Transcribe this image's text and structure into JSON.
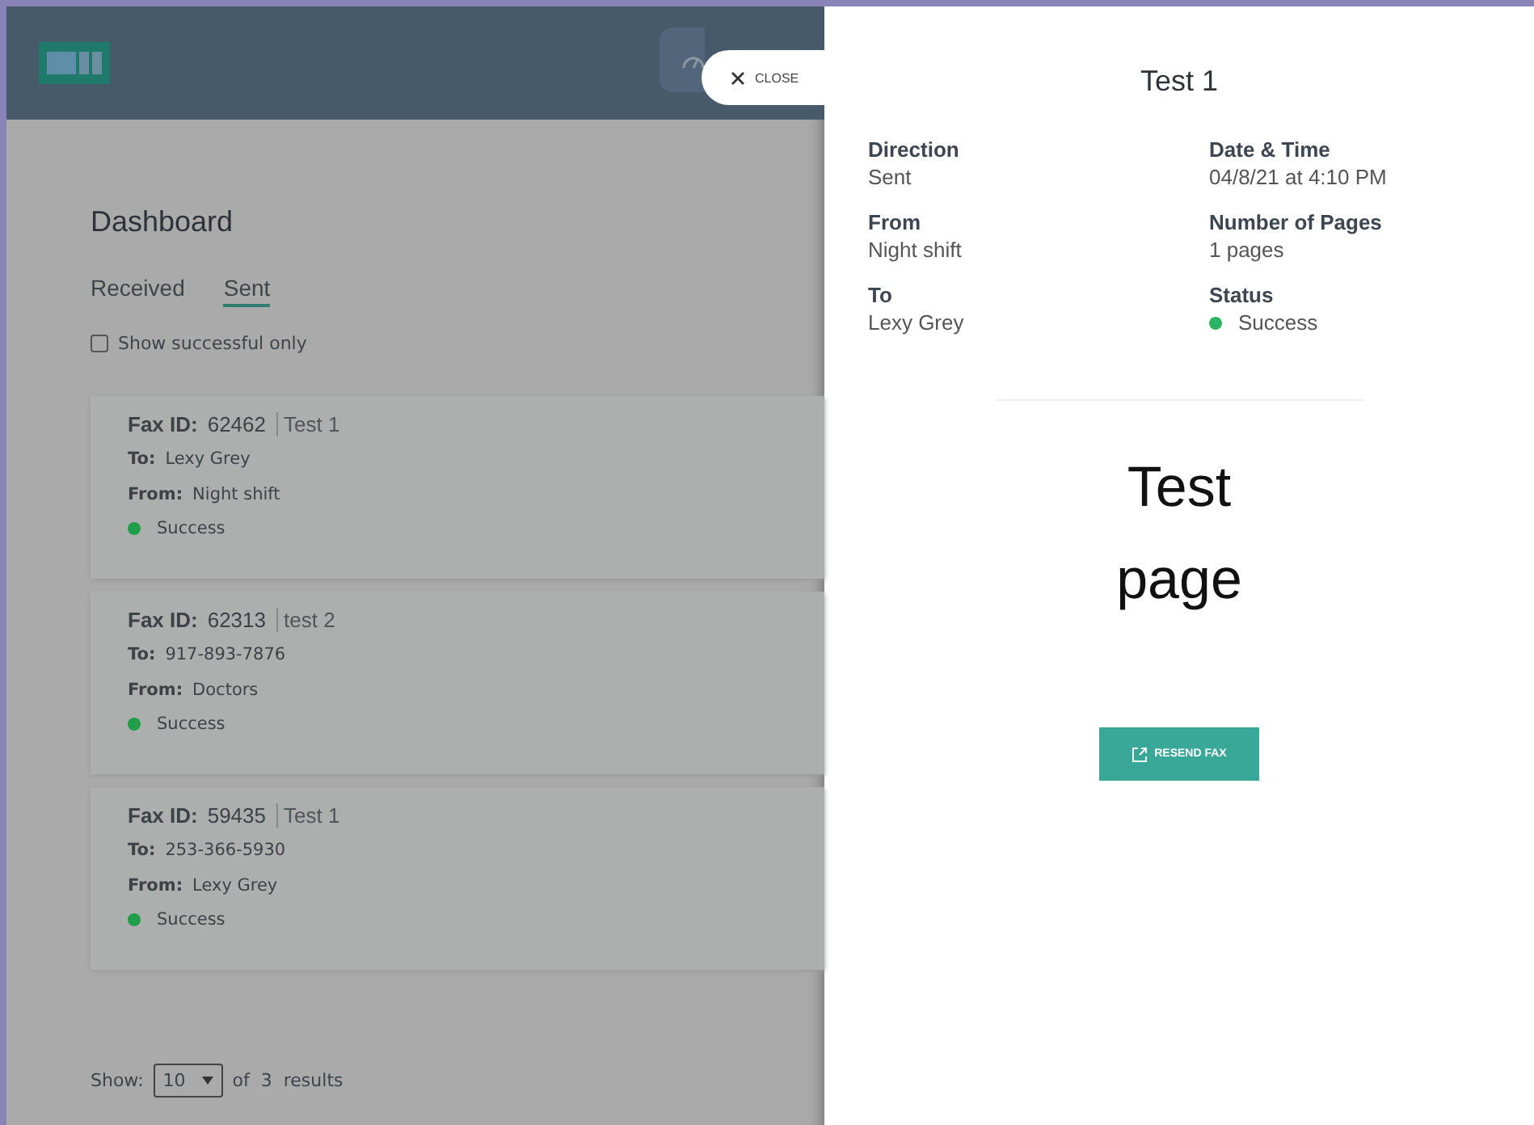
{
  "header": {
    "close_label": "CLOSE"
  },
  "dashboard": {
    "title": "Dashboard",
    "tabs": [
      {
        "label": "Received",
        "selected": false
      },
      {
        "label": "Sent",
        "selected": true
      }
    ],
    "filter": {
      "label": "Show successful only",
      "checked": false
    },
    "faxes": [
      {
        "id_label": "Fax ID:",
        "id": "62462",
        "subject": "Test 1",
        "to_label": "To:",
        "to": "Lexy Grey",
        "from_label": "From:",
        "from": "Night shift",
        "status": "Success",
        "color": "#1f9e4a"
      },
      {
        "id_label": "Fax ID:",
        "id": "62313",
        "subject": "test 2",
        "to_label": "To:",
        "to": "917-893-7876",
        "from_label": "From:",
        "from": "Doctors",
        "status": "Success",
        "color": "#1f9e4a"
      },
      {
        "id_label": "Fax ID:",
        "id": "59435",
        "subject": "Test 1",
        "to_label": "To:",
        "to": "253-366-5930",
        "from_label": "From:",
        "from": "Lexy Grey",
        "status": "Success",
        "color": "#1f9e4a"
      }
    ],
    "pager": {
      "show_label": "Show:",
      "page_size": "10",
      "summary": "of  3  results"
    }
  },
  "detail": {
    "title": "Test 1",
    "fields": [
      {
        "label": "Direction",
        "value": "Sent"
      },
      {
        "label": "Date & Time",
        "value": "04/8/21 at 4:10 PM"
      },
      {
        "label": "From",
        "value": "Night shift"
      },
      {
        "label": "Number of Pages",
        "value": "1 pages"
      },
      {
        "label": "To",
        "value": "Lexy Grey"
      },
      {
        "label": "Status",
        "value": "Success",
        "color": "#2bb463"
      }
    ],
    "preview_text": "Test page",
    "resend_label": "RESEND FAX"
  }
}
